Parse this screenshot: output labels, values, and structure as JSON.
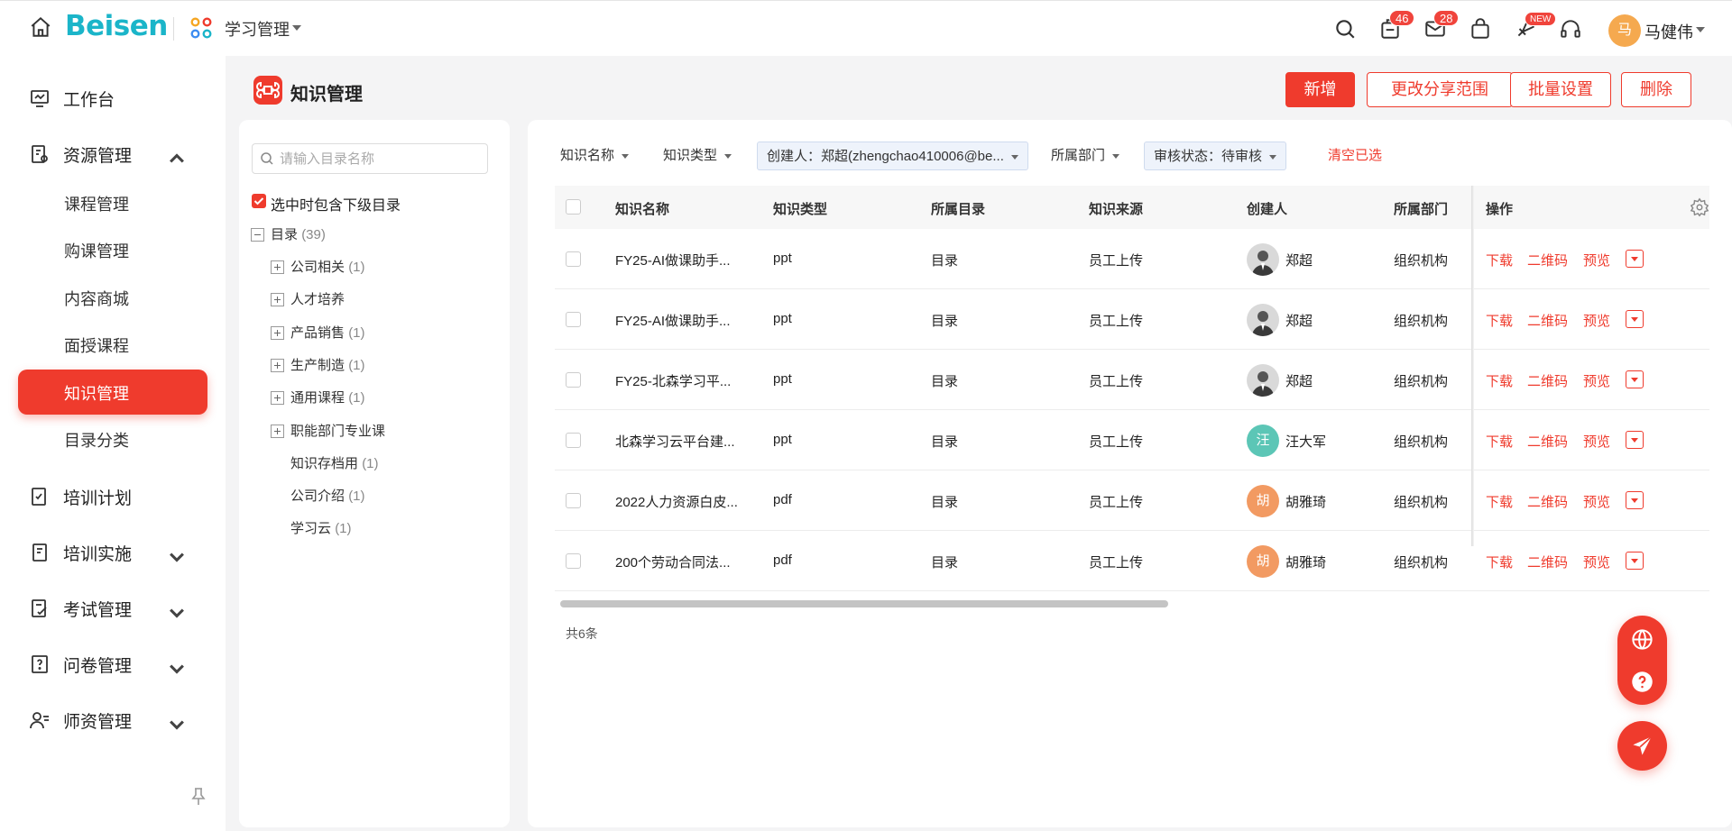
{
  "topbar": {
    "logo": "Beisen",
    "app_name": "学习管理",
    "badges": {
      "tasks": "46",
      "messages": "28",
      "new": "NEW"
    },
    "user": {
      "avatar_text": "马",
      "name": "马健伟"
    }
  },
  "sidebar": {
    "workbench": "工作台",
    "resource": "资源管理",
    "resource_items": [
      "课程管理",
      "购课管理",
      "内容商城",
      "面授课程",
      "知识管理",
      "目录分类"
    ],
    "plan": "培训计划",
    "implement": "培训实施",
    "exam": "考试管理",
    "survey": "问卷管理",
    "teacher": "师资管理"
  },
  "page": {
    "title": "知识管理",
    "buttons": {
      "add": "新增",
      "share": "更改分享范围",
      "batch": "批量设置",
      "delete": "删除"
    }
  },
  "tree": {
    "search_placeholder": "请输入目录名称",
    "include_sub": "选中时包含下级目录",
    "root": {
      "label": "目录",
      "count": "(39)"
    },
    "children": [
      {
        "label": "公司相关",
        "count": "(1)"
      },
      {
        "label": "人才培养",
        "count": ""
      },
      {
        "label": "产品销售",
        "count": "(1)"
      },
      {
        "label": "生产制造",
        "count": "(1)"
      },
      {
        "label": "通用课程",
        "count": "(1)"
      },
      {
        "label": "职能部门专业课",
        "count": ""
      },
      {
        "label": "知识存档用",
        "count": "(1)"
      },
      {
        "label": "公司介绍",
        "count": "(1)"
      },
      {
        "label": "学习云",
        "count": "(1)"
      }
    ]
  },
  "filters": {
    "name": "知识名称",
    "type": "知识类型",
    "creator": "创建人：郑超(zhengchao410006@be...",
    "dept": "所属部门",
    "status": "审核状态：待审核",
    "clear": "清空已选"
  },
  "table": {
    "columns": [
      "知识名称",
      "知识类型",
      "所属目录",
      "知识来源",
      "创建人",
      "所属部门",
      "操作"
    ],
    "ops": {
      "download": "下载",
      "qrcode": "二维码",
      "preview": "预览"
    },
    "rows": [
      {
        "name": "FY25-AI做课助手...",
        "type": "ppt",
        "dir": "目录",
        "source": "员工上传",
        "avatar": "",
        "creator": "郑超",
        "dept": "组织机构"
      },
      {
        "name": "FY25-AI做课助手...",
        "type": "ppt",
        "dir": "目录",
        "source": "员工上传",
        "avatar": "",
        "creator": "郑超",
        "dept": "组织机构"
      },
      {
        "name": "FY25-北森学习平...",
        "type": "ppt",
        "dir": "目录",
        "source": "员工上传",
        "avatar": "",
        "creator": "郑超",
        "dept": "组织机构"
      },
      {
        "name": "北森学习云平台建...",
        "type": "ppt",
        "dir": "目录",
        "source": "员工上传",
        "avatar": "汪",
        "creator": "汪大军",
        "dept": "组织机构"
      },
      {
        "name": "2022人力资源白皮...",
        "type": "pdf",
        "dir": "目录",
        "source": "员工上传",
        "avatar": "胡",
        "creator": "胡雅琦",
        "dept": "组织机构"
      },
      {
        "name": "200个劳动合同法...",
        "type": "pdf",
        "dir": "目录",
        "source": "员工上传",
        "avatar": "胡",
        "creator": "胡雅琦",
        "dept": "组织机构"
      }
    ],
    "total": "共6条"
  },
  "colors": {
    "accent": "#ef3b2d",
    "logo": "#1bb5c9",
    "avatar_teal": "#5cc6b6",
    "avatar_orange": "#f29a62"
  }
}
